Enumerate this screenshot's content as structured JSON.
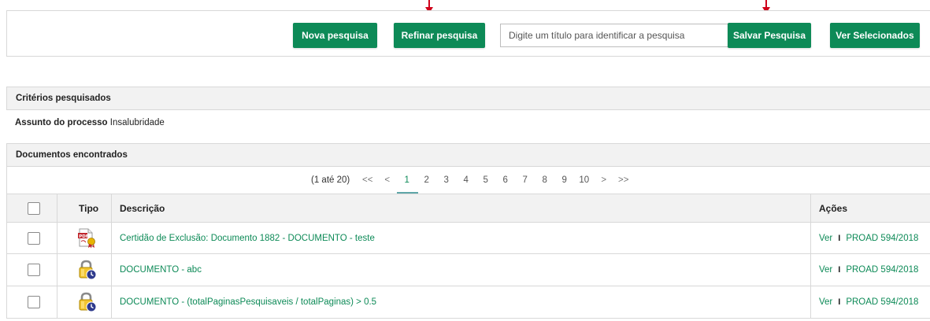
{
  "toolbar": {
    "nova_label": "Nova pesquisa",
    "refinar_label": "Refinar pesquisa",
    "search_placeholder": "Digite um título para identificar a pesquisa",
    "salvar_label": "Salvar Pesquisa",
    "ver_label": "Ver Selecionados"
  },
  "criteria": {
    "header": "Critérios pesquisados",
    "field_label": "Assunto do processo",
    "field_value": "Insalubridade"
  },
  "results": {
    "header": "Documentos encontrados",
    "pager": {
      "count_text": "(1 até 20)",
      "first": "<<",
      "prev": "<",
      "pages": [
        "1",
        "2",
        "3",
        "4",
        "5",
        "6",
        "7",
        "8",
        "9",
        "10"
      ],
      "current": "1",
      "next": ">",
      "last": ">>"
    },
    "columns": {
      "tipo": "Tipo",
      "descricao": "Descrição",
      "acoes": "Ações"
    },
    "rows": [
      {
        "icon": "pdf-certificate-icon",
        "descricao": "Certidão de Exclusão: Documento 1882 - DOCUMENTO - teste",
        "ver": "Ver",
        "proad": "PROAD 594/2018"
      },
      {
        "icon": "locked-document-icon",
        "descricao": "DOCUMENTO - abc",
        "ver": "Ver",
        "proad": "PROAD 594/2018"
      },
      {
        "icon": "locked-document-icon",
        "descricao": "DOCUMENTO - (totalPaginasPesquisaveis / totalPaginas) > 0.5",
        "ver": "Ver",
        "proad": "PROAD 594/2018"
      }
    ],
    "separator": "I"
  },
  "colors": {
    "accent": "#0d8a57",
    "arrow": "#d0021b",
    "header_bg": "#f2f2f2"
  }
}
